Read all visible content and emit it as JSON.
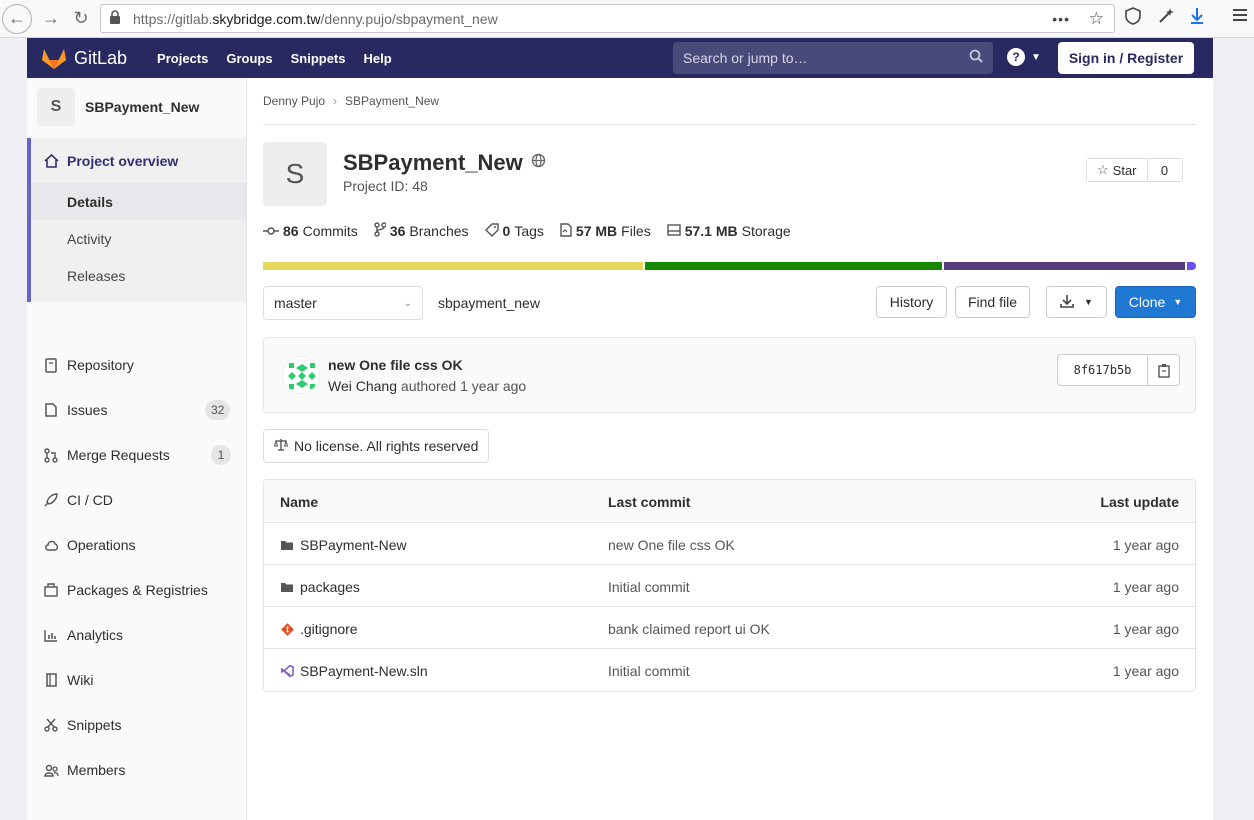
{
  "browser": {
    "url_prefix": "https://gitlab.",
    "url_domain": "skybridge.com.tw",
    "url_path": "/denny.pujo/sbpayment_new",
    "overflow": "•••"
  },
  "header": {
    "logo_text": "GitLab",
    "nav": [
      "Projects",
      "Groups",
      "Snippets",
      "Help"
    ],
    "search_placeholder": "Search or jump to…",
    "signin_label": "Sign in / Register"
  },
  "sidebar": {
    "project_initial": "S",
    "project_name": "SBPayment_New",
    "overview_label": "Project overview",
    "overview_items": [
      "Details",
      "Activity",
      "Releases"
    ],
    "items": [
      {
        "label": "Repository",
        "icon": "book-icon"
      },
      {
        "label": "Issues",
        "icon": "issues-icon",
        "count": "32"
      },
      {
        "label": "Merge Requests",
        "icon": "merge-request-icon",
        "count": "1"
      },
      {
        "label": "CI / CD",
        "icon": "rocket-icon"
      },
      {
        "label": "Operations",
        "icon": "cloud-icon"
      },
      {
        "label": "Packages & Registries",
        "icon": "package-icon"
      },
      {
        "label": "Analytics",
        "icon": "chart-icon"
      },
      {
        "label": "Wiki",
        "icon": "wiki-icon"
      },
      {
        "label": "Snippets",
        "icon": "scissors-icon"
      },
      {
        "label": "Members",
        "icon": "users-icon"
      }
    ]
  },
  "main": {
    "breadcrumb": [
      "Denny Pujo",
      "SBPayment_New"
    ],
    "project_initial": "S",
    "project_title": "SBPayment_New",
    "project_id": "Project ID: 48",
    "star_label": "Star",
    "star_count": "0",
    "stats": [
      {
        "value": "86",
        "label": "Commits"
      },
      {
        "value": "36",
        "label": "Branches"
      },
      {
        "value": "0",
        "label": "Tags"
      },
      {
        "value": "57 MB",
        "label": "Files"
      },
      {
        "value": "57.1 MB",
        "label": "Storage"
      }
    ],
    "languages": [
      {
        "color": "#e5d85c",
        "share": 0.41
      },
      {
        "color": "#178600",
        "share": 0.32
      },
      {
        "color": "#563d7c",
        "share": 0.26
      },
      {
        "color": "#6b4ff5",
        "share": 0.01
      }
    ],
    "branch": "master",
    "path": "sbpayment_new",
    "buttons": {
      "history": "History",
      "find_file": "Find file",
      "clone": "Clone"
    },
    "commit": {
      "title": "new One file css OK",
      "author": "Wei Chang",
      "meta": "authored 1 year ago",
      "sha": "8f617b5b"
    },
    "license": "No license. All rights reserved",
    "table": {
      "headers": [
        "Name",
        "Last commit",
        "Last update"
      ],
      "rows": [
        {
          "name": "SBPayment-New",
          "type": "folder-icon",
          "commit": "new One file css OK",
          "updated": "1 year ago"
        },
        {
          "name": "packages",
          "type": "folder-icon",
          "commit": "Initial commit",
          "updated": "1 year ago"
        },
        {
          "name": ".gitignore",
          "type": "git-icon",
          "commit": "bank claimed report ui OK",
          "updated": "1 year ago"
        },
        {
          "name": "SBPayment-New.sln",
          "type": "visual-studio-icon",
          "commit": "Initial commit",
          "updated": "1 year ago"
        }
      ]
    }
  }
}
